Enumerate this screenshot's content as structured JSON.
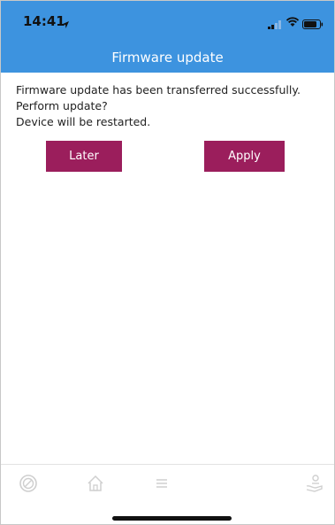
{
  "status_bar": {
    "time": "14:41"
  },
  "header": {
    "title": "Firmware update"
  },
  "message": {
    "line1": "Firmware update has been transferred successfully. Perform update?",
    "line2": "Device will be restarted."
  },
  "actions": {
    "later_label": "Later",
    "apply_label": "Apply"
  },
  "tab_bar": {
    "items": [
      "dial-icon",
      "home-icon",
      "menu-icon",
      "hand-person-icon"
    ]
  },
  "colors": {
    "header_bg": "#3d93df",
    "button_bg": "#9b1e5c",
    "button_text": "#ffffff"
  }
}
